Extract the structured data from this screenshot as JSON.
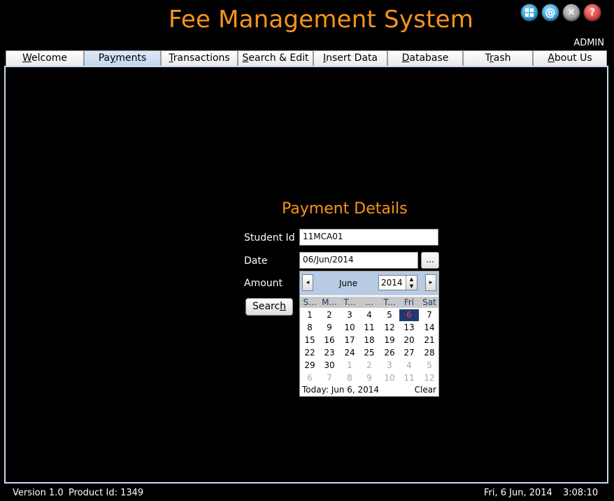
{
  "app": {
    "title": "Fee Management System",
    "user": "ADMIN"
  },
  "top_icons": [
    "grid-icon",
    "at-icon",
    "close-icon",
    "help-icon"
  ],
  "tabs": [
    {
      "pre": "",
      "u": "W",
      "post": "elcome"
    },
    {
      "pre": "Pa",
      "u": "y",
      "post": "ments"
    },
    {
      "pre": "",
      "u": "T",
      "post": "ransactions"
    },
    {
      "pre": "",
      "u": "S",
      "post": "earch & Edit"
    },
    {
      "pre": "",
      "u": "I",
      "post": "nsert Data"
    },
    {
      "pre": "",
      "u": "D",
      "post": "atabase"
    },
    {
      "pre": "T",
      "u": "r",
      "post": "ash"
    },
    {
      "pre": "",
      "u": "A",
      "post": "bout Us"
    }
  ],
  "form": {
    "title": "Payment Details",
    "student_id_label": "Student Id",
    "student_id_value": "11MCA01",
    "date_label": "Date",
    "date_value": "06/Jun/2014",
    "date_picker_button": "...",
    "amount_label": "Amount",
    "search_pre": "Searc",
    "search_u": "h",
    "search_post": ""
  },
  "calendar": {
    "month": "June",
    "year": "2014",
    "prev": "◂",
    "next": "▸",
    "spin_up": "▲",
    "spin_down": "▼",
    "weekdays": [
      "S...",
      "M...",
      "T...",
      "...",
      "T...",
      "Fri",
      "Sat"
    ],
    "days": [
      [
        "1",
        "2",
        "3",
        "4",
        "5",
        "6",
        "7"
      ],
      [
        "8",
        "9",
        "10",
        "11",
        "12",
        "13",
        "14"
      ],
      [
        "15",
        "16",
        "17",
        "18",
        "19",
        "20",
        "21"
      ],
      [
        "22",
        "23",
        "24",
        "25",
        "26",
        "27",
        "28"
      ],
      [
        "29",
        "30",
        "1",
        "2",
        "3",
        "4",
        "5"
      ],
      [
        "6",
        "7",
        "8",
        "9",
        "10",
        "11",
        "12"
      ]
    ],
    "selected_day": "6",
    "today_label": "Today: Jun 6, 2014",
    "clear_label": "Clear"
  },
  "status": {
    "version": "Version 1.0",
    "product": "Product Id: 1349",
    "date": "Fri, 6 Jun, 2014",
    "time": "3:08:10"
  }
}
